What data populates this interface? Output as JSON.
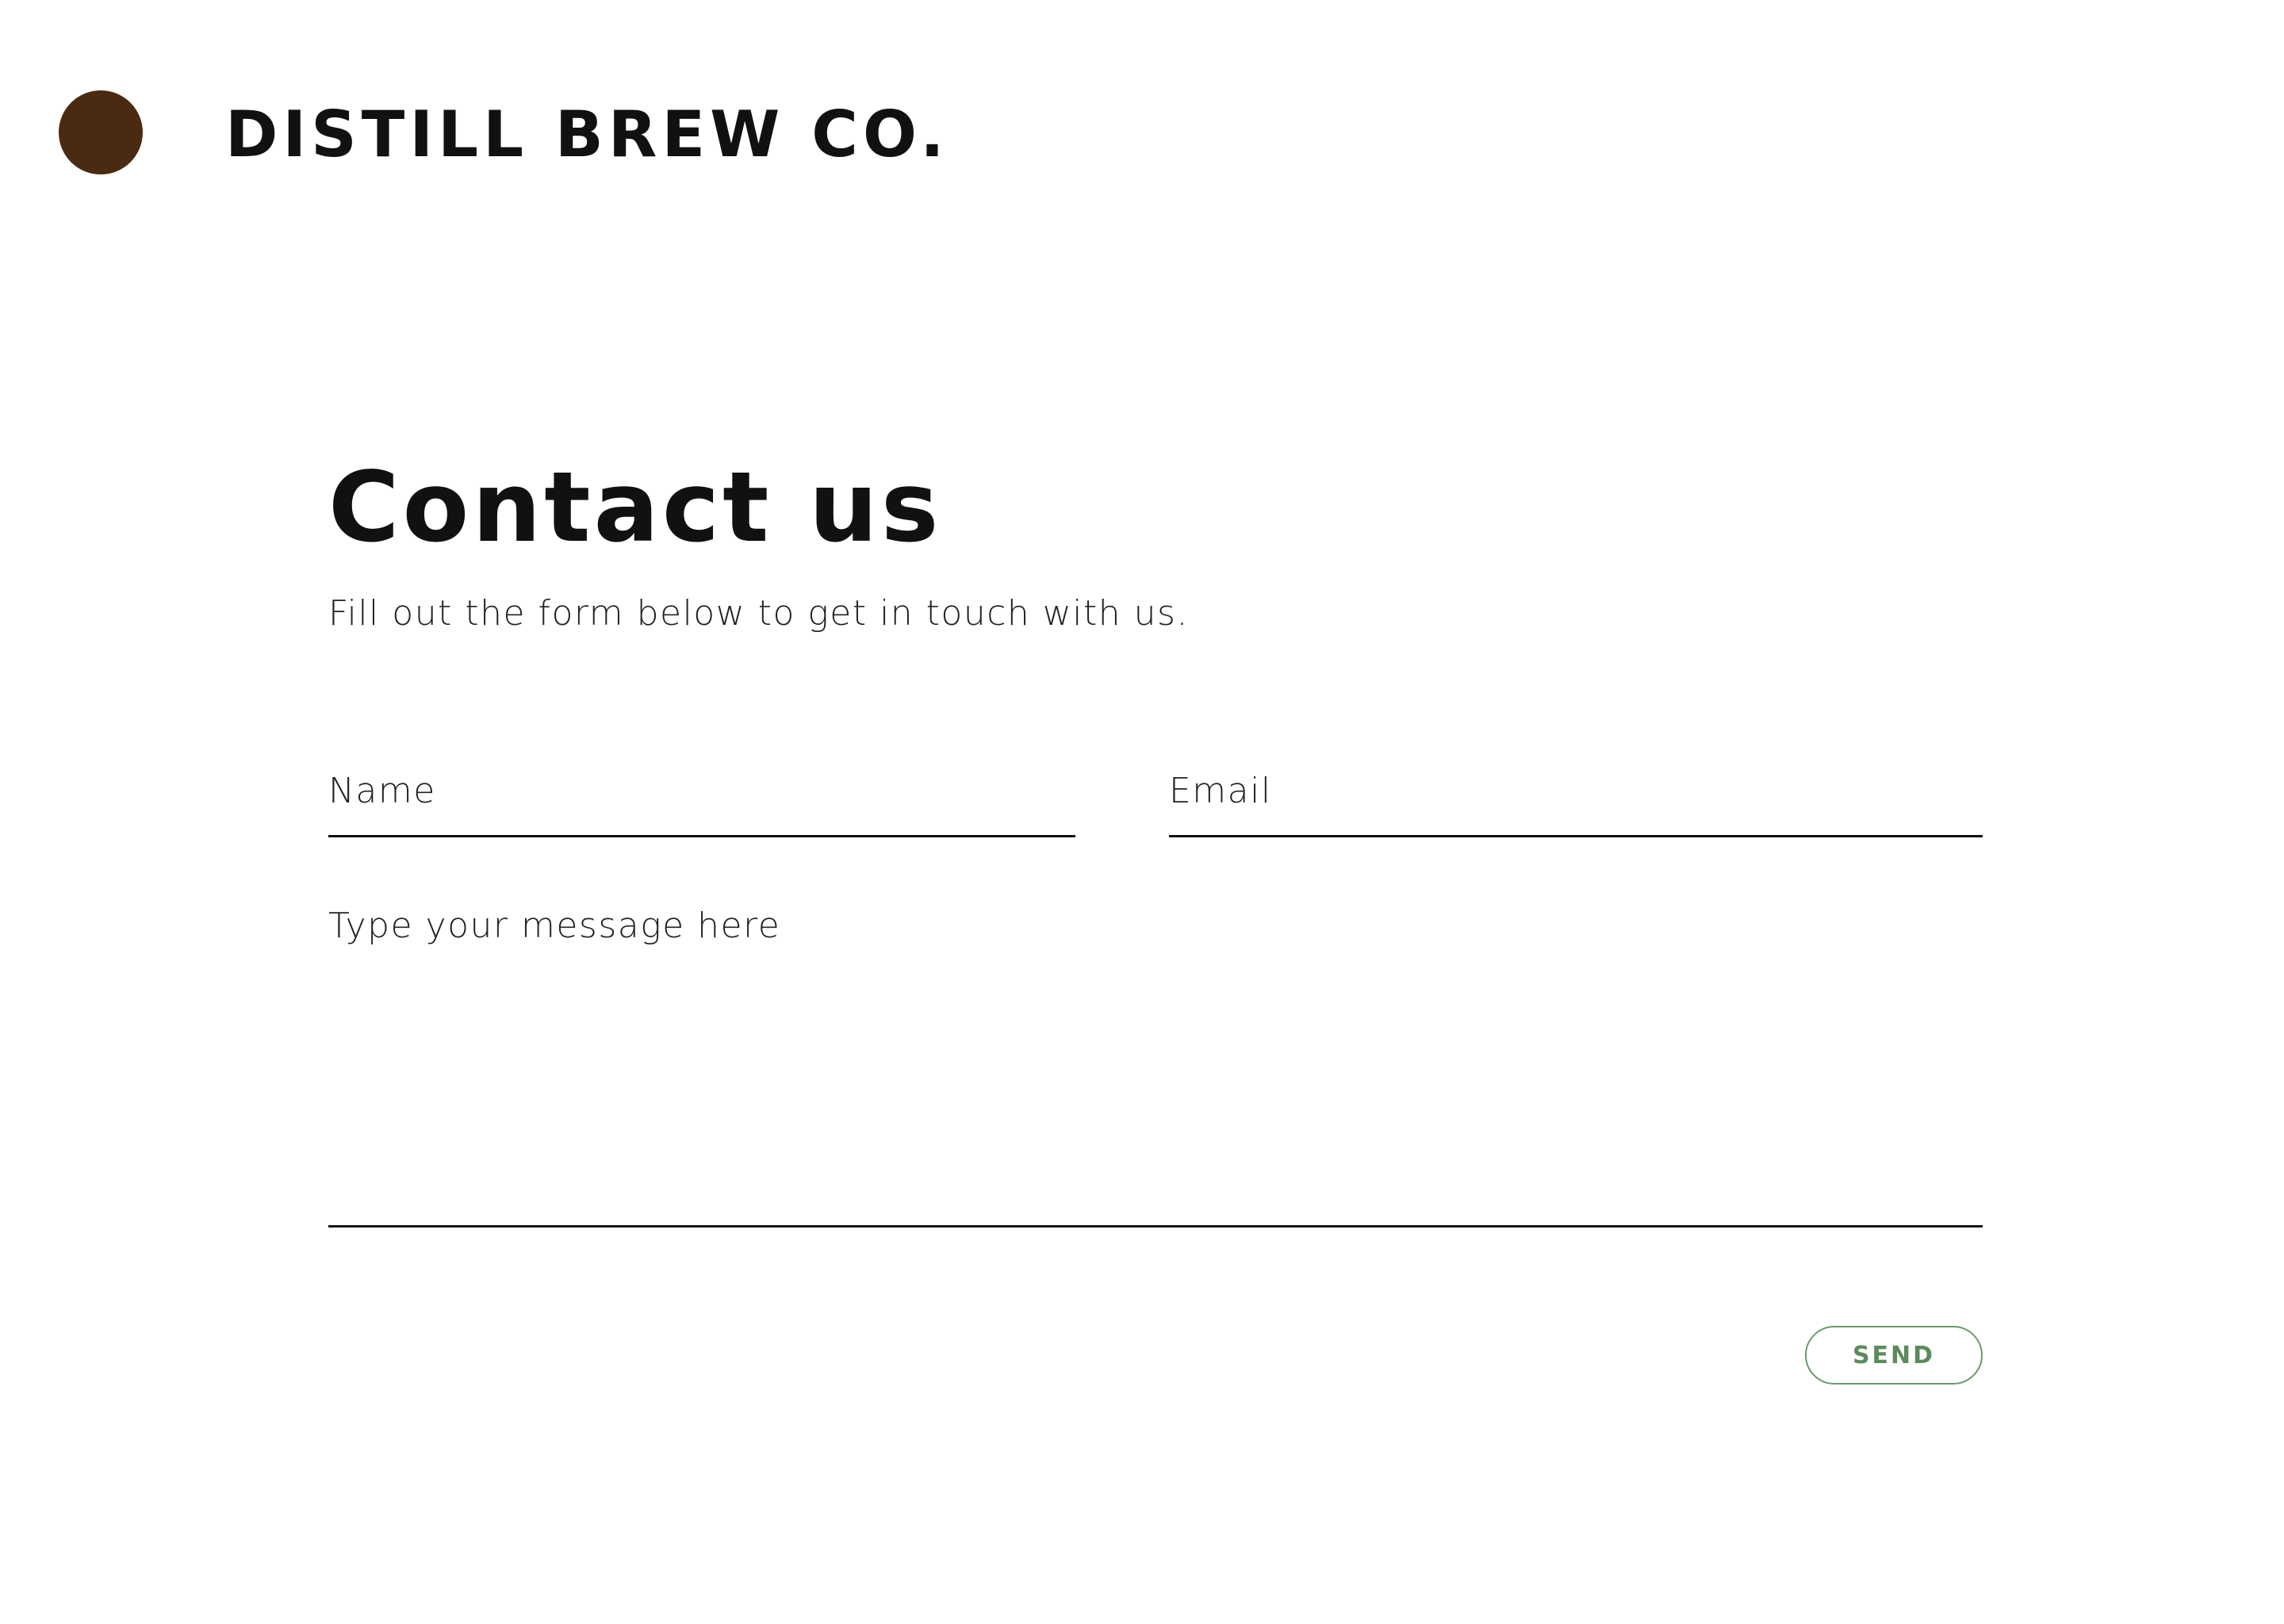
{
  "brand": {
    "name": "DISTILL BREW CO.",
    "logo_color": "#4a2a10"
  },
  "page": {
    "title": "Contact us",
    "subtitle": "Fill out the form below to get in touch with us."
  },
  "form": {
    "name_placeholder": "Name",
    "email_placeholder": "Email",
    "message_placeholder": "Type your message here",
    "send_label": "SEND",
    "send_color": "#5b8a5b"
  }
}
